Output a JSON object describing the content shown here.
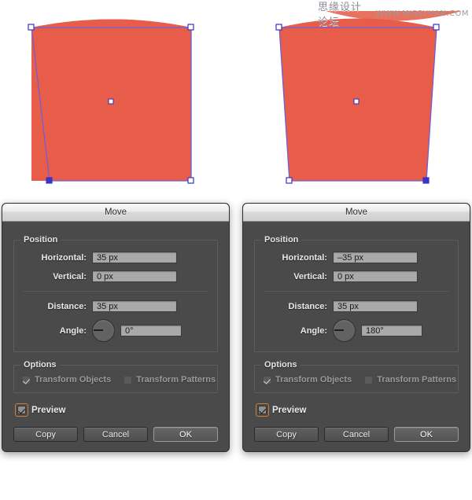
{
  "watermark": {
    "cn_text": "思缘设计论坛",
    "url_text": "WWW.MISSYUAN.COM"
  },
  "artwork": {
    "fill_color": "#e85c4a",
    "path_stroke_color": "#6f5fd0",
    "anchor_fill_color": "#3b34c9",
    "anchor_empty_color": "#ffffff",
    "left_shape_name": "tapered-left-shape",
    "right_shape_name": "tapered-symmetric-shape"
  },
  "dialogs": [
    {
      "id": "left",
      "title": "Move",
      "position_group": {
        "legend": "Position",
        "horizontal_label": "Horizontal:",
        "horizontal_value": "35 px",
        "vertical_label": "Vertical:",
        "vertical_value": "0 px",
        "distance_label": "Distance:",
        "distance_value": "35 px",
        "angle_label": "Angle:",
        "angle_value": "0°",
        "angle_needle_deg": 180
      },
      "options_group": {
        "legend": "Options",
        "transform_objects_label": "Transform Objects",
        "transform_objects_checked": true,
        "transform_patterns_label": "Transform Patterns",
        "transform_patterns_checked": false
      },
      "preview": {
        "label": "Preview",
        "checked": true,
        "focus_color": "#c8803c"
      },
      "buttons": {
        "copy": "Copy",
        "cancel": "Cancel",
        "ok": "OK"
      }
    },
    {
      "id": "right",
      "title": "Move",
      "position_group": {
        "legend": "Position",
        "horizontal_label": "Horizontal:",
        "horizontal_value": "–35 px",
        "vertical_label": "Vertical:",
        "vertical_value": "0 px",
        "distance_label": "Distance:",
        "distance_value": "35 px",
        "angle_label": "Angle:",
        "angle_value": "180°",
        "angle_needle_deg": 180
      },
      "options_group": {
        "legend": "Options",
        "transform_objects_label": "Transform Objects",
        "transform_objects_checked": true,
        "transform_patterns_label": "Transform Patterns",
        "transform_patterns_checked": false
      },
      "preview": {
        "label": "Preview",
        "checked": true,
        "focus_color": "#c8803c"
      },
      "buttons": {
        "copy": "Copy",
        "cancel": "Cancel",
        "ok": "OK"
      }
    }
  ]
}
